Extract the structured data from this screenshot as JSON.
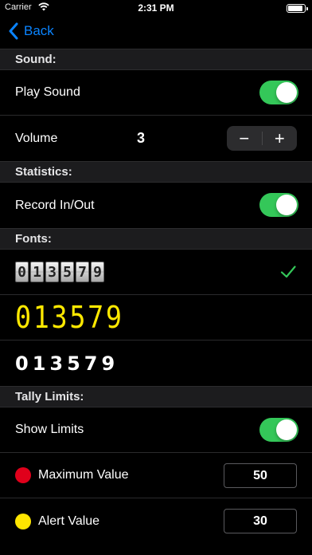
{
  "status_bar": {
    "carrier": "Carrier",
    "time": "2:31 PM"
  },
  "nav": {
    "back_label": "Back"
  },
  "sections": {
    "sound": {
      "title": "Sound:",
      "play_sound_label": "Play Sound",
      "play_sound_on": true,
      "volume_label": "Volume",
      "volume_value": "3",
      "minus_glyph": "−",
      "plus_glyph": "+"
    },
    "statistics": {
      "title": "Statistics:",
      "record_label": "Record In/Out",
      "record_on": true
    },
    "fonts": {
      "title": "Fonts:",
      "options": [
        {
          "style": "flip-counter",
          "digits": [
            "0",
            "1",
            "3",
            "5",
            "7",
            "9"
          ],
          "selected": true
        },
        {
          "style": "lcd-yellow",
          "digits": "013579",
          "selected": false
        },
        {
          "style": "bold-white",
          "digits": "013579",
          "selected": false
        }
      ]
    },
    "tally_limits": {
      "title": "Tally Limits:",
      "show_limits_label": "Show Limits",
      "show_limits_on": true,
      "max_label": "Maximum Value",
      "max_value": "50",
      "max_color": "#e0001b",
      "alert_label": "Alert Value",
      "alert_value": "30",
      "alert_color": "#ffe600"
    }
  },
  "colors": {
    "accent": "#0a84ff",
    "toggle_on": "#34c759",
    "checkmark": "#34c759",
    "lcd_digit": "#ffe900"
  }
}
